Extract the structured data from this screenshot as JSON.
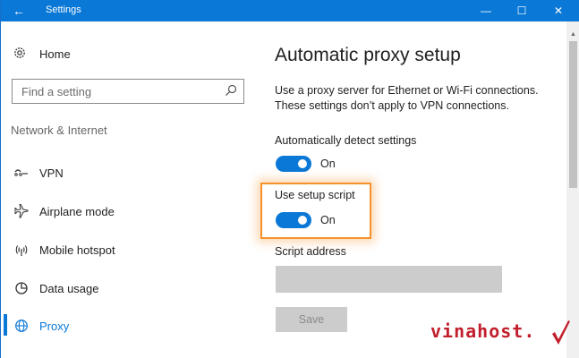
{
  "window": {
    "title": "Settings"
  },
  "sidebar": {
    "home_label": "Home",
    "search_placeholder": "Find a setting",
    "section_title": "Network & Internet",
    "items": [
      {
        "label": "VPN",
        "icon": "vpn-icon"
      },
      {
        "label": "Airplane mode",
        "icon": "airplane-icon"
      },
      {
        "label": "Mobile hotspot",
        "icon": "hotspot-icon"
      },
      {
        "label": "Data usage",
        "icon": "data-usage-icon"
      },
      {
        "label": "Proxy",
        "icon": "globe-icon",
        "active": true
      }
    ]
  },
  "main": {
    "title": "Automatic proxy setup",
    "description_line1": "Use a proxy server for Ethernet or Wi-Fi connections.",
    "description_line2": "These settings don’t apply to VPN connections.",
    "auto_detect": {
      "label": "Automatically detect settings",
      "state_text": "On",
      "on": true
    },
    "setup_script": {
      "label": "Use setup script",
      "state_text": "On",
      "on": true
    },
    "script_address": {
      "label": "Script address",
      "value": ""
    },
    "save_label": "Save"
  },
  "watermark": {
    "text": "vinahost."
  },
  "colors": {
    "accent": "#0a78d7",
    "highlight": "#f5922b",
    "watermark": "#c21f2c"
  }
}
